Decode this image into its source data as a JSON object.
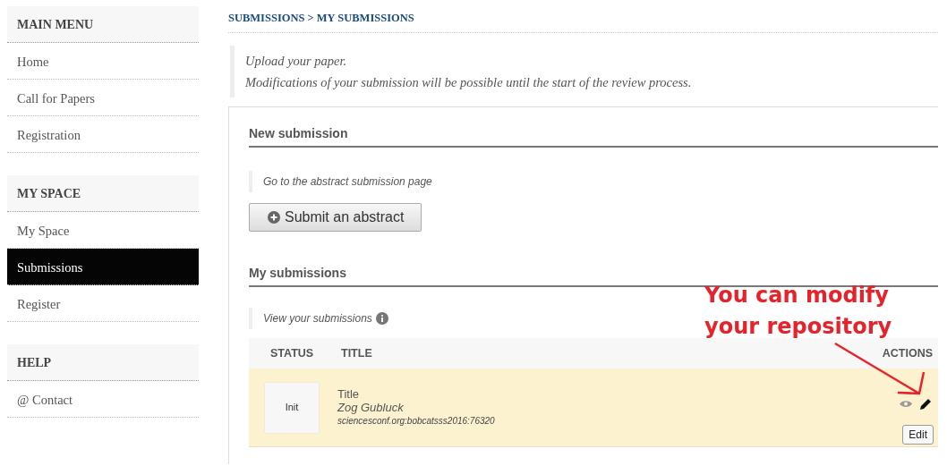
{
  "sidebar": {
    "sections": [
      {
        "title": "MAIN MENU",
        "items": [
          {
            "label": "Home",
            "selected": false
          },
          {
            "label": "Call for Papers",
            "selected": false
          },
          {
            "label": "Registration",
            "selected": false
          }
        ]
      },
      {
        "title": "MY SPACE",
        "items": [
          {
            "label": "My Space",
            "selected": false
          },
          {
            "label": "Submissions",
            "selected": true
          },
          {
            "label": "Register",
            "selected": false
          }
        ]
      },
      {
        "title": "HELP",
        "items": [
          {
            "label": "@ Contact",
            "selected": false
          }
        ]
      }
    ]
  },
  "breadcrumb": "SUBMISSIONS > MY SUBMISSIONS",
  "intro": [
    "Upload your paper.",
    "Modifications of your submission will be possible until the start of the review process."
  ],
  "new_submission": {
    "heading": "New submission",
    "note": "Go to the abstract submission page",
    "button": "Submit an abstract"
  },
  "my_submissions": {
    "heading": "My submissions",
    "note": "View your submissions",
    "table": {
      "columns": [
        "STATUS",
        "TITLE",
        "ACTIONS"
      ],
      "rows": [
        {
          "status": "Init",
          "title": "Title",
          "author": "Zog Gubluck",
          "id": "sciencesconf.org:bobcatsss2016:76320",
          "button": "Edit"
        }
      ]
    }
  },
  "annotation": {
    "lines": [
      "You can modify",
      "your repository"
    ]
  }
}
